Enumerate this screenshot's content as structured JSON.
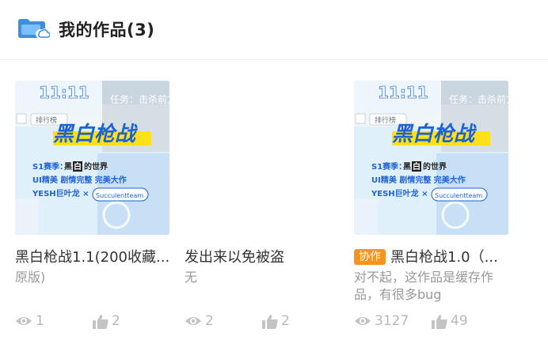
{
  "header": {
    "title": "我的作品(3)",
    "icon": "folder-cloud-icon"
  },
  "thumbnail": {
    "clock": "11:11",
    "game_title": "黑白枪战",
    "task_text": "任务：击杀前方",
    "rank_text": "排行榜",
    "season_prefix": "S1赛季：",
    "season_highlight": "白",
    "season_black": "黑",
    "season_suffix": "的世界",
    "tagline": "UI精美  剧情完整  完美大作",
    "author": "YESH巨叶龙 ×",
    "partner": "Succulentteam",
    "colors": {
      "blue": "#1e63d6",
      "yellow": "#ffe11a",
      "sky": "#dff0fb"
    }
  },
  "works": [
    {
      "title": "黑白枪战1.1(200收藏...",
      "badge": "",
      "description": "原版)",
      "views": "1",
      "likes": "2",
      "has_thumbnail": true
    },
    {
      "title": "发出来以免被盗",
      "badge": "",
      "description": "无",
      "views": "2",
      "likes": "2",
      "has_thumbnail": false
    },
    {
      "title": "黑白枪战1.0（...",
      "badge": "协作",
      "description": "对不起，这作品是缓存作品，有很多bug",
      "views": "3127",
      "likes": "49",
      "has_thumbnail": true
    }
  ],
  "icons": {
    "views": "eye-icon",
    "likes": "thumbs-up-icon"
  }
}
